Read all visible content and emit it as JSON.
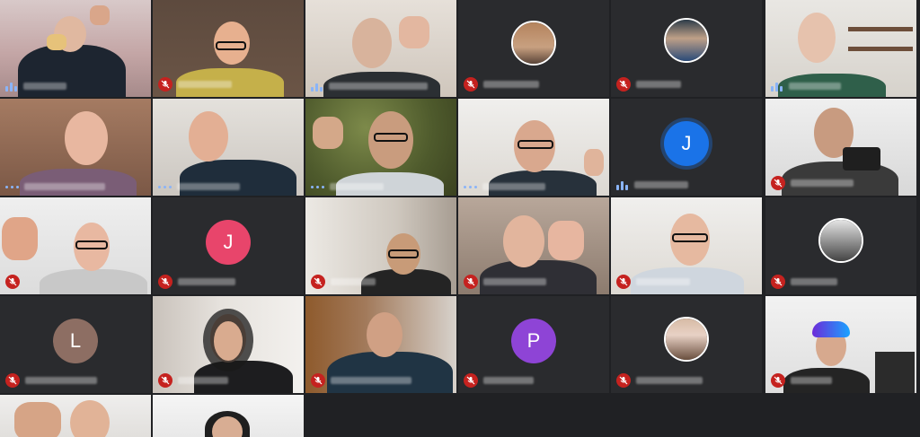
{
  "grid": {
    "tiles": [
      {
        "id": "t1",
        "type": "video",
        "status": "speaking"
      },
      {
        "id": "t2",
        "type": "video",
        "status": "muted"
      },
      {
        "id": "t3",
        "type": "video",
        "status": "speaking"
      },
      {
        "id": "t4",
        "type": "photo-avatar",
        "status": "muted"
      },
      {
        "id": "t5",
        "type": "photo-avatar",
        "status": "muted"
      },
      {
        "id": "t6",
        "type": "video",
        "status": "speaking"
      },
      {
        "id": "t7",
        "type": "video",
        "status": "speaking"
      },
      {
        "id": "t8",
        "type": "video",
        "status": "speaking"
      },
      {
        "id": "t9",
        "type": "video",
        "status": "speaking"
      },
      {
        "id": "t10",
        "type": "video",
        "status": "speaking"
      },
      {
        "id": "t11",
        "type": "letter-avatar",
        "status": "speaking",
        "initial": "J",
        "color": "#1a73e8"
      },
      {
        "id": "t12",
        "type": "video",
        "status": "muted"
      },
      {
        "id": "t13",
        "type": "video",
        "status": "muted"
      },
      {
        "id": "t14",
        "type": "letter-avatar",
        "status": "muted",
        "initial": "J",
        "color": "#e8456b"
      },
      {
        "id": "t15",
        "type": "video",
        "status": "muted"
      },
      {
        "id": "t16",
        "type": "video",
        "status": "muted"
      },
      {
        "id": "t17",
        "type": "video",
        "status": "muted"
      },
      {
        "id": "t18",
        "type": "photo-avatar",
        "status": "muted"
      },
      {
        "id": "t19",
        "type": "letter-avatar",
        "status": "muted",
        "initial": "L",
        "color": "#8d6e63"
      },
      {
        "id": "t20",
        "type": "video",
        "status": "muted"
      },
      {
        "id": "t21",
        "type": "video",
        "status": "muted"
      },
      {
        "id": "t22",
        "type": "letter-avatar",
        "status": "muted",
        "initial": "P",
        "color": "#8e44d6"
      },
      {
        "id": "t23",
        "type": "photo-avatar",
        "status": "muted"
      },
      {
        "id": "t24",
        "type": "video",
        "status": "muted"
      },
      {
        "id": "t25",
        "type": "video",
        "status": "none"
      },
      {
        "id": "t26",
        "type": "video",
        "status": "none"
      }
    ]
  },
  "colors": {
    "background": "#202124",
    "muted_red": "#c5221f",
    "speaking_blue": "#8ab4f8"
  }
}
